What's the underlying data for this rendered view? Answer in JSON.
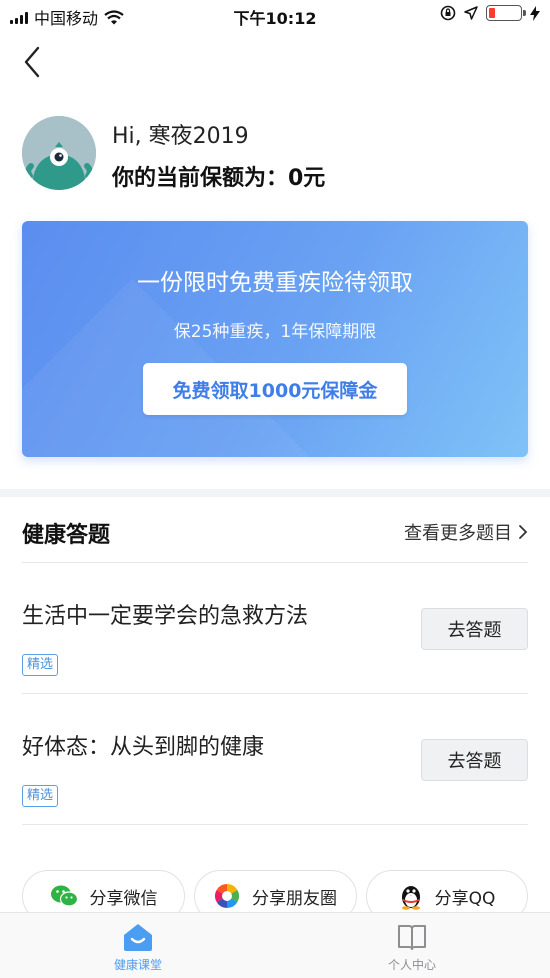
{
  "status_bar": {
    "carrier": "中国移动",
    "time": "下午10:12"
  },
  "profile": {
    "greeting": "Hi, 寒夜2019",
    "coverage": "你的当前保额为：0元"
  },
  "promo": {
    "title": "一份限时免费重疾险待领取",
    "subtitle": "保25种重疾，1年保障期限",
    "button": "免费领取1000元保障金"
  },
  "quiz": {
    "section_title": "健康答题",
    "more_link": "查看更多题目",
    "items": [
      {
        "title": "生活中一定要学会的急救方法",
        "tag": "精选",
        "button": "去答题"
      },
      {
        "title": "好体态：从头到脚的健康",
        "tag": "精选",
        "button": "去答题"
      }
    ]
  },
  "share": {
    "wechat": "分享微信",
    "moments": "分享朋友圈",
    "qq": "分享QQ"
  },
  "tabbar": {
    "items": [
      {
        "label": "健康课堂",
        "icon": "house-smile-icon",
        "active": true
      },
      {
        "label": "个人中心",
        "icon": "open-book-icon",
        "active": false
      }
    ]
  },
  "colors": {
    "accent": "#4b93dc",
    "promo_start": "#5b8df0",
    "promo_end": "#7fc2f7",
    "battery_low": "#ff3b30",
    "tab_inactive": "#8e8e93"
  }
}
